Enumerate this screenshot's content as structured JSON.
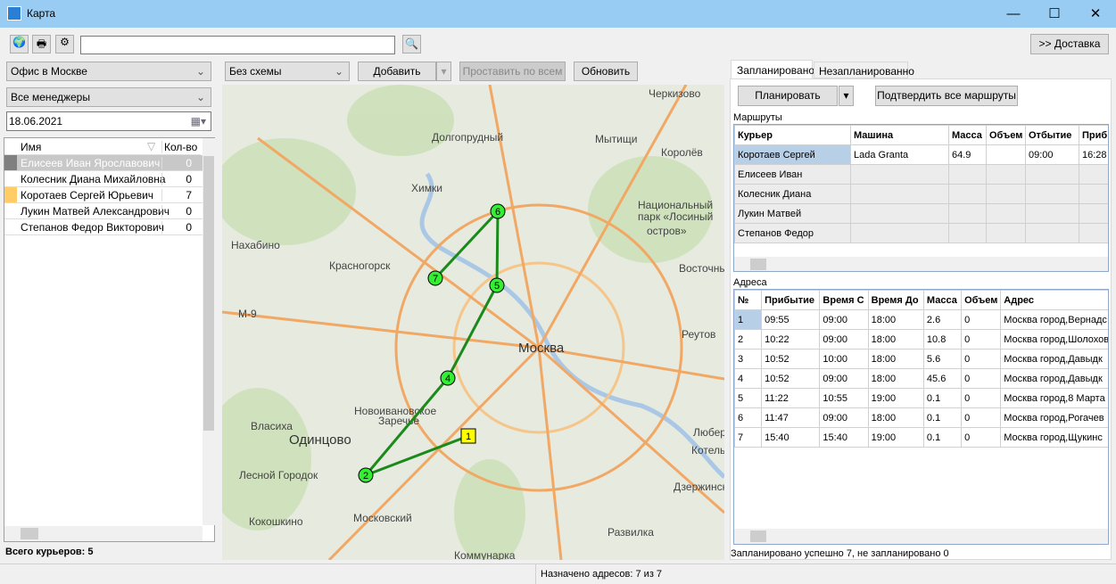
{
  "window": {
    "title": "Карта"
  },
  "toolbar": {
    "search_value": "",
    "delivery_label": ">> Доставка"
  },
  "left": {
    "office": "Офис в Москве",
    "managers": "Все менеджеры",
    "date": "18.06.2021",
    "columns": [
      "Имя",
      "Кол-во"
    ],
    "couriers": [
      {
        "name": "Елисеев Иван Ярославович",
        "count": "0",
        "color": "#808080"
      },
      {
        "name": "Колесник Диана Михайловна",
        "count": "0",
        "color": "#ffffff"
      },
      {
        "name": "Коротаев Сергей Юрьевич",
        "count": "7",
        "color": "#ffcc66"
      },
      {
        "name": "Лукин Матвей Александрович",
        "count": "0",
        "color": "#ffffff"
      },
      {
        "name": "Степанов Федор Викторович",
        "count": "0",
        "color": "#ffffff"
      }
    ],
    "total": "Всего курьеров: 5"
  },
  "map": {
    "scheme": "Без схемы",
    "add": "Добавить",
    "set_all": "Проставить по всем",
    "refresh": "Обновить",
    "labels": [
      "Долгопрудный",
      "Мытищи",
      "Королёв",
      "Химки",
      "Красногорск",
      "Москва",
      "Одинцово",
      "Новоивановское",
      "Заречье",
      "Власиха",
      "Лесной Городок",
      "Кокошкино",
      "Московский",
      "Коммунарка",
      "Развилка",
      "Реутов",
      "Восточный",
      "Черкизово",
      "Нахабино",
      "М-9",
      "Национальный",
      "парк «Лосиный",
      "остров»",
      "Люберцы",
      "Котельники",
      "Дзержинский"
    ],
    "markers": [
      "1",
      "2",
      "4",
      "5",
      "6",
      "7"
    ],
    "route_color": "#1a8a1a"
  },
  "right": {
    "tabs": [
      "Запланировано",
      "Незапланированно"
    ],
    "plan": "Планировать",
    "confirm": "Подтвердить все маршруты",
    "routes_label": "Маршруты",
    "routes_columns": [
      "Курьер",
      "Машина",
      "Масса",
      "Объем",
      "Отбытие",
      "Приб"
    ],
    "routes": [
      [
        "Коротаев Сергей",
        "Lada Granta",
        "64.9",
        "",
        "09:00",
        "16:28"
      ],
      [
        "Елисеев Иван",
        "",
        "",
        "",
        "",
        ""
      ],
      [
        "Колесник Диана",
        "",
        "",
        "",
        "",
        ""
      ],
      [
        "Лукин Матвей",
        "",
        "",
        "",
        "",
        ""
      ],
      [
        "Степанов Федор",
        "",
        "",
        "",
        "",
        ""
      ]
    ],
    "addr_label": "Адреса",
    "addr_columns": [
      "№",
      "Прибытие",
      "Время С",
      "Время До",
      "Масса",
      "Объем",
      "Адрес"
    ],
    "addresses": [
      [
        "1",
        "09:55",
        "09:00",
        "18:00",
        "2.6",
        "0",
        "Москва город,Вернадс"
      ],
      [
        "2",
        "10:22",
        "09:00",
        "18:00",
        "10.8",
        "0",
        "Москва город,Шолохов"
      ],
      [
        "3",
        "10:52",
        "10:00",
        "18:00",
        "5.6",
        "0",
        "Москва город,Давыдк"
      ],
      [
        "4",
        "10:52",
        "09:00",
        "18:00",
        "45.6",
        "0",
        "Москва город,Давыдк"
      ],
      [
        "5",
        "11:22",
        "10:55",
        "19:00",
        "0.1",
        "0",
        "Москва город,8 Марта"
      ],
      [
        "6",
        "11:47",
        "09:00",
        "18:00",
        "0.1",
        "0",
        "Москва город,Рогачев"
      ],
      [
        "7",
        "15:40",
        "15:40",
        "19:00",
        "0.1",
        "0",
        "Москва город,Щукинс"
      ]
    ],
    "status": "Запланировано успешно 7, не запланировано 0"
  },
  "statusbar": {
    "text": "Назначено адресов: 7 из 7"
  }
}
